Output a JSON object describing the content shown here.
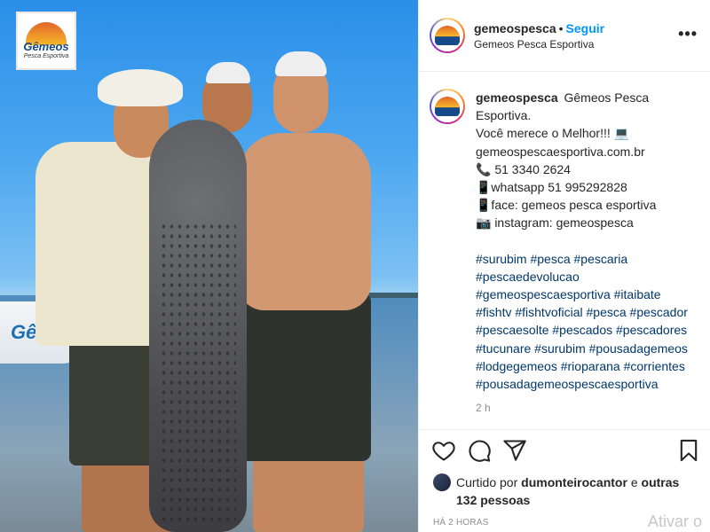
{
  "post": {
    "header": {
      "username": "gemeospesca",
      "separator": "•",
      "follow_label": "Seguir",
      "subtitle": "Gemeos Pesca Esportiva",
      "more_label": "•••"
    },
    "photo": {
      "logo_word": "Gêmeos",
      "logo_sub": "Pesca Esportiva",
      "boat_text": "Gêmeos"
    },
    "caption": {
      "username": "gemeospesca",
      "lines": [
        "Gêmeos Pesca",
        "Esportiva.",
        "Você merece o Melhor!!! 💻",
        "gemeospescaesportiva.com.br",
        "📞 51 3340 2624",
        "📱whatsapp 51 995292828",
        "📱face: gemeos pesca esportiva",
        "📷 instagram: gemeospesca"
      ],
      "hashtag_lines": [
        "#surubim #pesca #pescaria",
        "#pescaedevolucao",
        "#gemeospescaesportiva #itaibate",
        "#fishtv #fishtvoficial #pesca #pescador",
        "#pescaesolte #pescados #pescadores",
        "#tucunare #surubim #pousadagemeos",
        "#lodgegemeos #rioparana #corrientes",
        "#pousadagemeospescaesportiva"
      ],
      "time": "2 h"
    },
    "liked_by": {
      "prefix": "Curtido por",
      "user": "dumonteirocantor",
      "and": "e",
      "others": "outras 132 pessoas"
    },
    "time_ago": "HÁ 2 HORAS",
    "watermark": "Ativar o"
  },
  "icons": [
    "heart-icon",
    "comment-icon",
    "share-icon",
    "bookmark-icon",
    "more-icon"
  ],
  "colors": {
    "link_blue": "#0095f6",
    "hashtag": "#00376b",
    "muted": "#8e8e8e"
  }
}
